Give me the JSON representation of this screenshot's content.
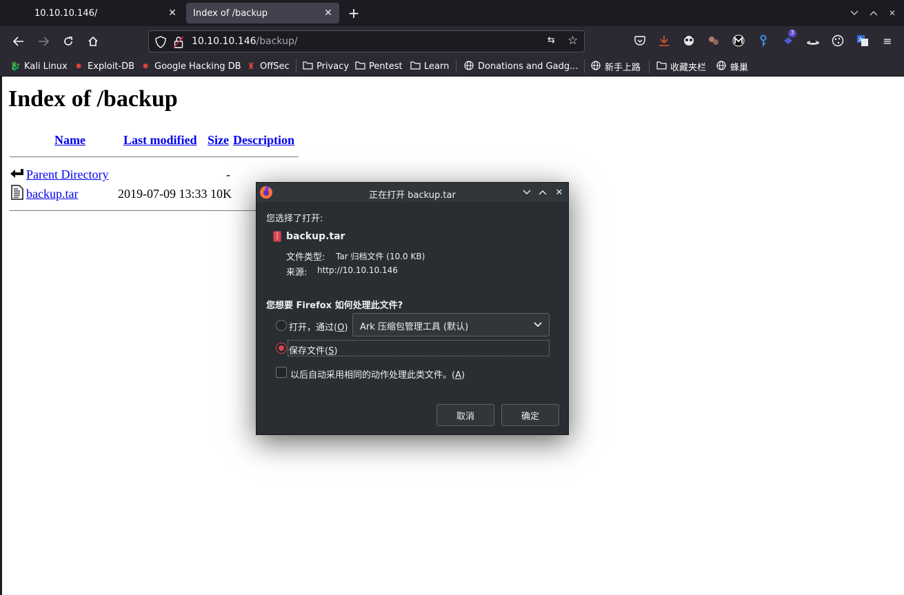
{
  "tabs": [
    {
      "label": "10.10.10.146/"
    },
    {
      "label": "Index of /backup"
    }
  ],
  "urlbar": {
    "host": "10.10.10.146",
    "path": "/backup/"
  },
  "bookmarks": [
    {
      "label": "Kali Linux"
    },
    {
      "label": "Exploit-DB"
    },
    {
      "label": "Google Hacking DB"
    },
    {
      "label": "OffSec"
    },
    {
      "label": "Privacy"
    },
    {
      "label": "Pentest"
    },
    {
      "label": "Learn"
    },
    {
      "label": "Donations and Gadg..."
    },
    {
      "label": "新手上路"
    },
    {
      "label": "收藏夹栏"
    },
    {
      "label": "蜂巢"
    }
  ],
  "extensions": {
    "badge_count": "3"
  },
  "page": {
    "title": "Index of /backup",
    "columns": {
      "name": "Name",
      "last_modified": "Last modified",
      "size": "Size",
      "description": "Description"
    },
    "rows": [
      {
        "name": "Parent Directory",
        "last_modified": "",
        "size": "-"
      },
      {
        "name": "backup.tar",
        "last_modified": "2019-07-09 13:33",
        "size": "10K"
      }
    ]
  },
  "dialog": {
    "title": "正在打开 backup.tar",
    "intro": "您选择了打开:",
    "filename": "backup.tar",
    "type_label": "文件类型:",
    "type_value": "Tar 归档文件 (10.0 KB)",
    "source_label": "来源:",
    "source_value": "http://10.10.10.146",
    "question": "您想要 Firefox 如何处理此文件?",
    "open_with_label": "打开，通过",
    "open_with_key": "O",
    "open_with_app": "Ark 压缩包管理工具 (默认)",
    "save_label": "保存文件",
    "save_key": "S",
    "remember_label": "以后自动采用相同的动作处理此类文件。",
    "remember_key": "A",
    "cancel": "取消",
    "ok": "确定",
    "selected_option": "save"
  }
}
